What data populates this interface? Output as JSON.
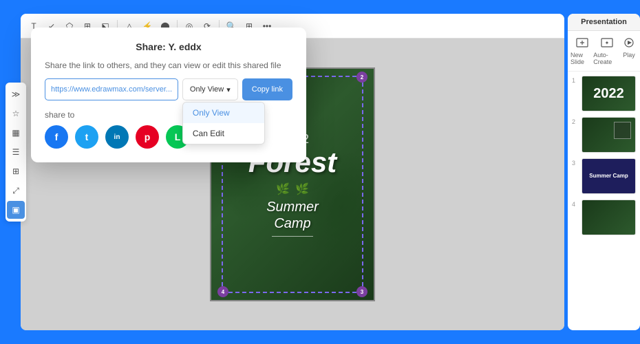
{
  "app": {
    "background_color": "#1a7aff"
  },
  "share_dialog": {
    "title": "Share: Y. eddx",
    "description": "Share the link to others, and they can view or edit this shared file",
    "link_url": "https://www.edrawmax.com/server...",
    "view_mode": "Only View",
    "copy_button": "Copy link",
    "share_to_label": "share to",
    "dropdown_options": [
      "Only View",
      "Can Edit"
    ],
    "social_icons": [
      {
        "name": "facebook",
        "color": "#1877f2",
        "letter": "f"
      },
      {
        "name": "twitter",
        "color": "#1da1f2",
        "letter": "t"
      },
      {
        "name": "linkedin",
        "color": "#0077b5",
        "letter": "in"
      },
      {
        "name": "pinterest",
        "color": "#e60023",
        "letter": "p"
      },
      {
        "name": "line",
        "color": "#06c755",
        "letter": "L"
      }
    ]
  },
  "slide_content": {
    "year": "2022",
    "title": "Forest",
    "subtitle_line1": "Summer",
    "subtitle_line2": "Camp"
  },
  "right_panel": {
    "title": "Presentation",
    "tools": [
      {
        "label": "New Slide",
        "icon": "➕"
      },
      {
        "label": "Auto-Create",
        "icon": "✦"
      },
      {
        "label": "Play",
        "icon": "▶"
      }
    ],
    "slides": [
      {
        "num": "1",
        "type": "title",
        "year": "2022",
        "big": "2022"
      },
      {
        "num": "2",
        "type": "dark"
      },
      {
        "num": "3",
        "type": "camp",
        "text": "Summer Camp"
      },
      {
        "num": "4",
        "type": "dark"
      }
    ]
  },
  "toolbar": {
    "icons": [
      "T",
      "↙",
      "⬠",
      "⬕",
      "⬗",
      "△",
      "⚡",
      "⬤",
      "◎",
      "⟳",
      "🔍",
      "⊞"
    ]
  },
  "mini_toolbar": {
    "icons": [
      "≫",
      "☆",
      "▦",
      "☰",
      "⊞",
      "⤢",
      "▣"
    ]
  }
}
